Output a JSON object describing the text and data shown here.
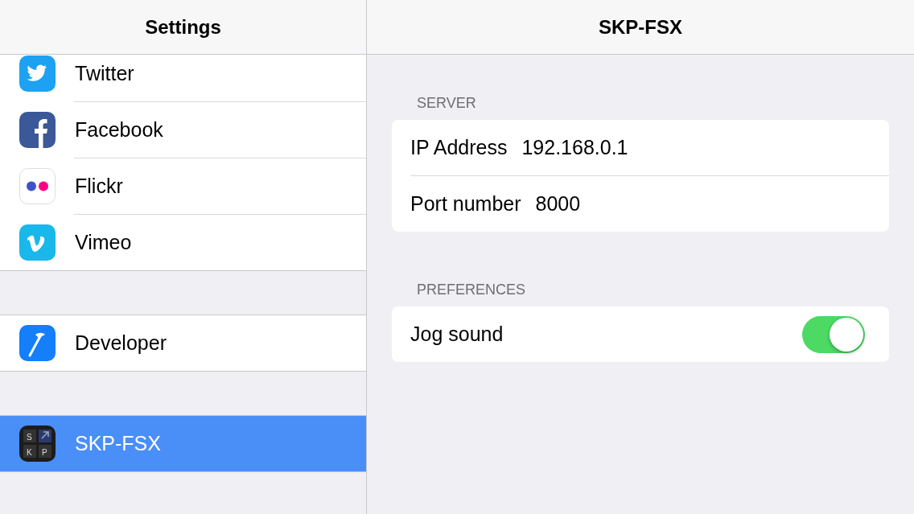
{
  "sidebar": {
    "title": "Settings",
    "groups": [
      {
        "items": [
          {
            "label": "Twitter",
            "kind": "twitter",
            "selected": false
          },
          {
            "label": "Facebook",
            "kind": "facebook",
            "selected": false
          },
          {
            "label": "Flickr",
            "kind": "flickr",
            "selected": false
          },
          {
            "label": "Vimeo",
            "kind": "vimeo",
            "selected": false
          }
        ]
      },
      {
        "items": [
          {
            "label": "Developer",
            "kind": "developer",
            "selected": false
          }
        ]
      },
      {
        "items": [
          {
            "label": "SKP-FSX",
            "kind": "app",
            "icon_letters": [
              "S",
              "K",
              "P"
            ],
            "selected": true
          }
        ]
      }
    ]
  },
  "detail": {
    "title": "SKP-FSX",
    "sections": [
      {
        "header": "SERVER",
        "rows": [
          {
            "kind": "field",
            "label": "IP Address",
            "value": "192.168.0.1"
          },
          {
            "kind": "field",
            "label": "Port number",
            "value": "8000"
          }
        ]
      },
      {
        "header": "PREFERENCES",
        "rows": [
          {
            "kind": "toggle",
            "label": "Jog sound",
            "on": true
          }
        ]
      }
    ]
  }
}
